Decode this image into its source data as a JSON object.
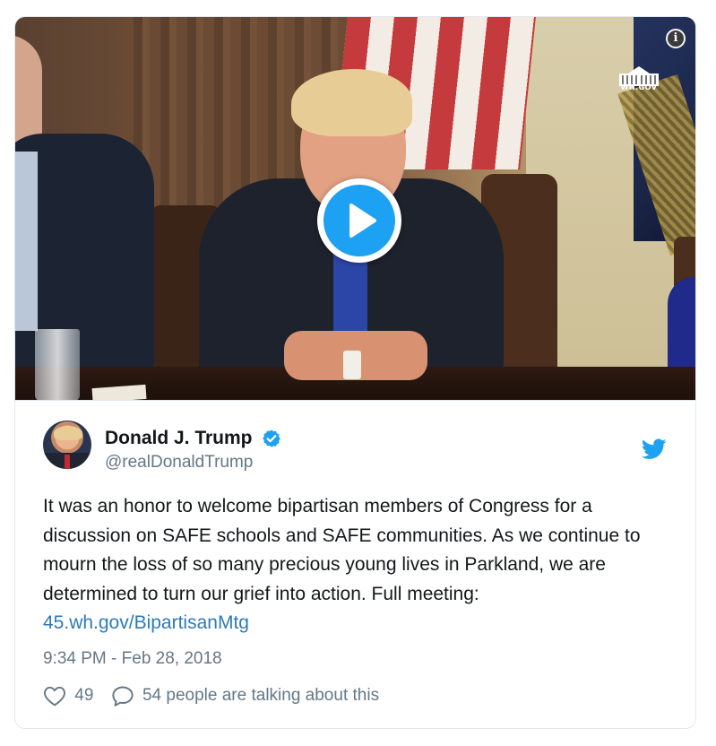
{
  "video": {
    "watermark": "WH.GOV",
    "info_glyph": "i"
  },
  "author": {
    "name": "Donald J. Trump",
    "handle": "@realDonaldTrump",
    "verified": true
  },
  "tweet": {
    "text_before_link": "It was an honor to welcome bipartisan members of Congress for a discussion on SAFE schools and SAFE communities. As we continue to mourn the loss of so many precious young lives in Parkland, we are determined to turn our grief into action. Full meeting: ",
    "link_text": "45.wh.gov/BipartisanMtg",
    "timestamp": "9:34 PM - Feb 28, 2018"
  },
  "stats": {
    "likes": "49",
    "talking": "54 people are talking about this"
  },
  "colors": {
    "brand_blue": "#1da1f2",
    "link_blue": "#2b7bb9",
    "secondary_text": "#657786",
    "border": "#e1e8ed"
  },
  "icons": {
    "play": "play-icon",
    "info": "info-icon",
    "verified": "verified-badge-icon",
    "twitter": "twitter-bird-icon",
    "like": "heart-icon",
    "reply": "speech-bubble-icon",
    "logo": "white-house-logo"
  }
}
